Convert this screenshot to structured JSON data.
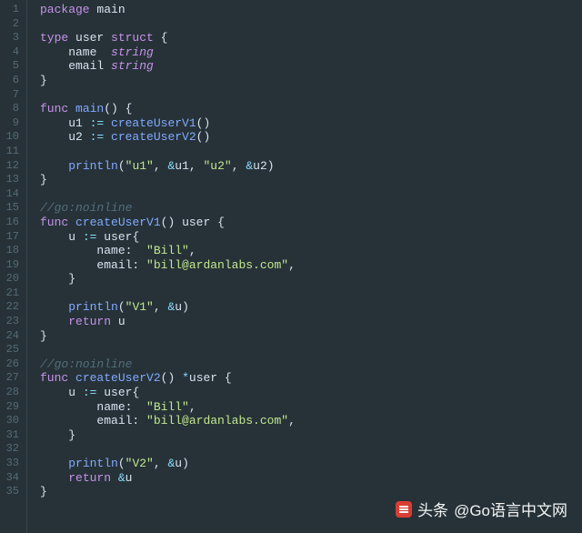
{
  "lines": {
    "l1": [
      [
        "k",
        "package"
      ],
      [
        "w",
        " main"
      ]
    ],
    "l2": [],
    "l3": [
      [
        "k",
        "type"
      ],
      [
        "w",
        " user "
      ],
      [
        "k",
        "struct"
      ],
      [
        "w",
        " "
      ],
      [
        "p",
        "{"
      ]
    ],
    "l4": [
      [
        "w",
        "    name  "
      ],
      [
        "t",
        "string"
      ]
    ],
    "l5": [
      [
        "w",
        "    email "
      ],
      [
        "t",
        "string"
      ]
    ],
    "l6": [
      [
        "p",
        "}"
      ]
    ],
    "l7": [],
    "l8": [
      [
        "k",
        "func"
      ],
      [
        "w",
        " "
      ],
      [
        "fn",
        "main"
      ],
      [
        "p",
        "()"
      ],
      [
        "w",
        " "
      ],
      [
        "p",
        "{"
      ]
    ],
    "l9": [
      [
        "w",
        "    u1 "
      ],
      [
        "op",
        ":="
      ],
      [
        "w",
        " "
      ],
      [
        "fn",
        "createUserV1"
      ],
      [
        "p",
        "()"
      ]
    ],
    "l10": [
      [
        "w",
        "    u2 "
      ],
      [
        "op",
        ":="
      ],
      [
        "w",
        " "
      ],
      [
        "fn",
        "createUserV2"
      ],
      [
        "p",
        "()"
      ]
    ],
    "l11": [],
    "l12": [
      [
        "w",
        "    "
      ],
      [
        "fn",
        "println"
      ],
      [
        "p",
        "("
      ],
      [
        "s",
        "\"u1\""
      ],
      [
        "p",
        ", "
      ],
      [
        "op",
        "&"
      ],
      [
        "w",
        "u1"
      ],
      [
        "p",
        ", "
      ],
      [
        "s",
        "\"u2\""
      ],
      [
        "p",
        ", "
      ],
      [
        "op",
        "&"
      ],
      [
        "w",
        "u2"
      ],
      [
        "p",
        ")"
      ]
    ],
    "l13": [
      [
        "p",
        "}"
      ]
    ],
    "l14": [],
    "l15": [
      [
        "c",
        "//go:noinline"
      ]
    ],
    "l16": [
      [
        "k",
        "func"
      ],
      [
        "w",
        " "
      ],
      [
        "fn",
        "createUserV1"
      ],
      [
        "p",
        "()"
      ],
      [
        "w",
        " user "
      ],
      [
        "p",
        "{"
      ]
    ],
    "l17": [
      [
        "w",
        "    u "
      ],
      [
        "op",
        ":="
      ],
      [
        "w",
        " user"
      ],
      [
        "p",
        "{"
      ]
    ],
    "l18": [
      [
        "w",
        "        name:  "
      ],
      [
        "s",
        "\"Bill\""
      ],
      [
        "p",
        ","
      ]
    ],
    "l19": [
      [
        "w",
        "        email: "
      ],
      [
        "s",
        "\"bill@ardanlabs.com\""
      ],
      [
        "p",
        ","
      ]
    ],
    "l20": [
      [
        "w",
        "    "
      ],
      [
        "p",
        "}"
      ]
    ],
    "l21": [],
    "l22": [
      [
        "w",
        "    "
      ],
      [
        "fn",
        "println"
      ],
      [
        "p",
        "("
      ],
      [
        "s",
        "\"V1\""
      ],
      [
        "p",
        ", "
      ],
      [
        "op",
        "&"
      ],
      [
        "w",
        "u"
      ],
      [
        "p",
        ")"
      ]
    ],
    "l23": [
      [
        "w",
        "    "
      ],
      [
        "k",
        "return"
      ],
      [
        "w",
        " u"
      ]
    ],
    "l24": [
      [
        "p",
        "}"
      ]
    ],
    "l25": [],
    "l26": [
      [
        "c",
        "//go:noinline"
      ]
    ],
    "l27": [
      [
        "k",
        "func"
      ],
      [
        "w",
        " "
      ],
      [
        "fn",
        "createUserV2"
      ],
      [
        "p",
        "()"
      ],
      [
        "w",
        " "
      ],
      [
        "op",
        "*"
      ],
      [
        "w",
        "user "
      ],
      [
        "p",
        "{"
      ]
    ],
    "l28": [
      [
        "w",
        "    u "
      ],
      [
        "op",
        ":="
      ],
      [
        "w",
        " user"
      ],
      [
        "p",
        "{"
      ]
    ],
    "l29": [
      [
        "w",
        "        name:  "
      ],
      [
        "s",
        "\"Bill\""
      ],
      [
        "p",
        ","
      ]
    ],
    "l30": [
      [
        "w",
        "        email: "
      ],
      [
        "s",
        "\"bill@ardanlabs.com\""
      ],
      [
        "p",
        ","
      ]
    ],
    "l31": [
      [
        "w",
        "    "
      ],
      [
        "p",
        "}"
      ]
    ],
    "l32": [],
    "l33": [
      [
        "w",
        "    "
      ],
      [
        "fn",
        "println"
      ],
      [
        "p",
        "("
      ],
      [
        "s",
        "\"V2\""
      ],
      [
        "p",
        ", "
      ],
      [
        "op",
        "&"
      ],
      [
        "w",
        "u"
      ],
      [
        "p",
        ")"
      ]
    ],
    "l34": [
      [
        "w",
        "    "
      ],
      [
        "k",
        "return"
      ],
      [
        "w",
        " "
      ],
      [
        "op",
        "&"
      ],
      [
        "w",
        "u"
      ]
    ],
    "l35": [
      [
        "p",
        "}"
      ]
    ]
  },
  "total_lines": 35,
  "watermark": {
    "prefix": "头条",
    "text": "@Go语言中文网"
  }
}
